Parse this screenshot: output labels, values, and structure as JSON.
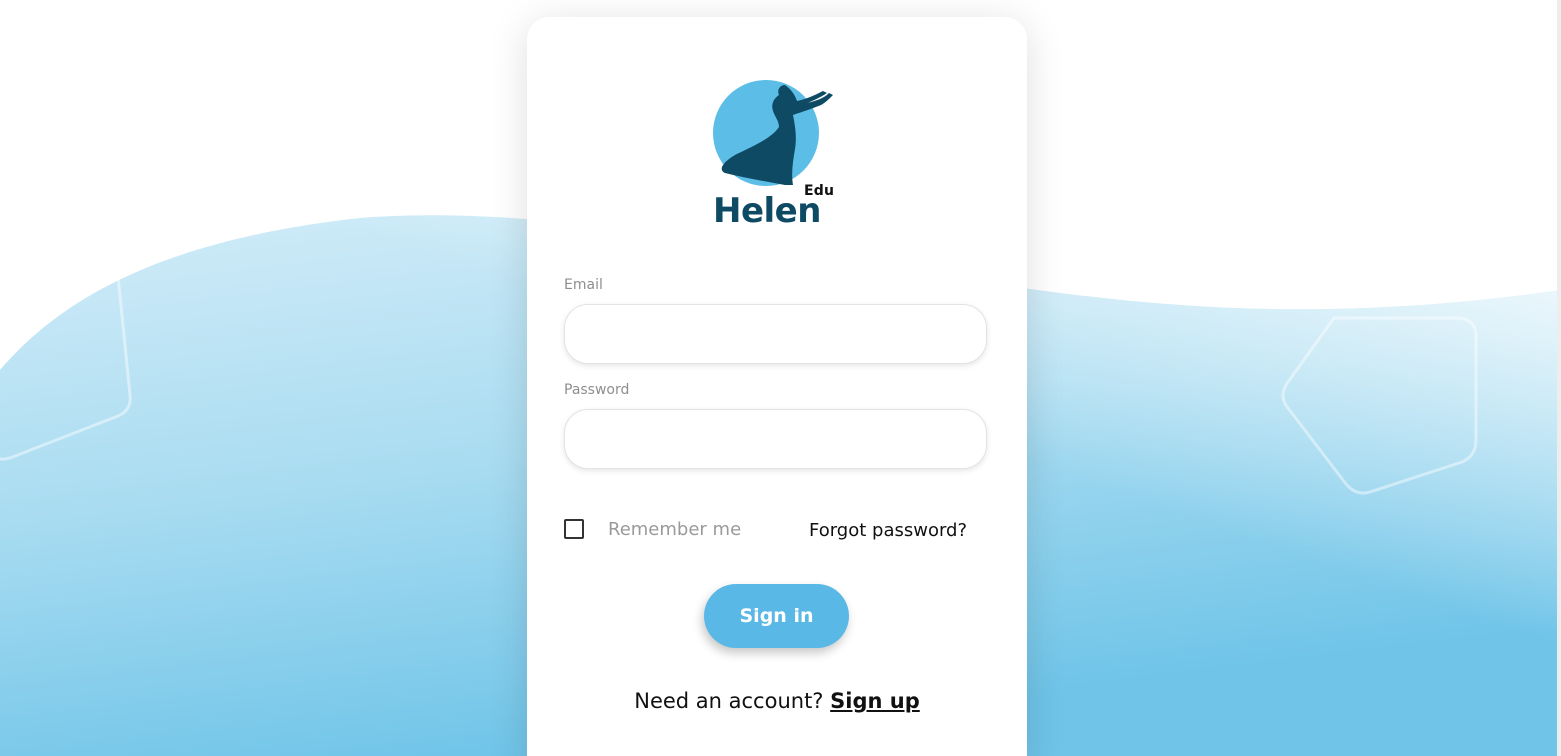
{
  "brand": {
    "name": "Helen",
    "suffix": "Edu",
    "logo_icon": "woman-silhouette-circle-icon",
    "colors": {
      "primary": "#0e4a63",
      "accent": "#5ab8e6",
      "background_wave": "#a9dcf2"
    }
  },
  "login_form": {
    "email_label": "Email",
    "email_value": "",
    "password_label": "Password",
    "password_value": "",
    "remember_label": "Remember me",
    "remember_checked": false,
    "forgot_label": "Forgot password?",
    "submit_label": "Sign in"
  },
  "footer": {
    "prompt": "Need an account?",
    "signup_label": "Sign up"
  }
}
